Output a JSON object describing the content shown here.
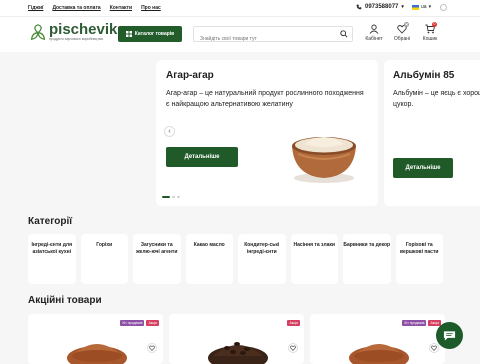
{
  "topbar": {
    "links": [
      "Гіджиї",
      "Доставка та оплата",
      "Контакти",
      "Про нас"
    ],
    "phone": "0973588077",
    "lang": "ua"
  },
  "header": {
    "logo_name": "pischevik",
    "logo_tagline": "продукти харчового виробництва",
    "catalog_label": "Каталог товарів",
    "search_placeholder": "Знайдіть свої товари тут",
    "icons": [
      {
        "label": "Кабінет",
        "icon": "user-icon"
      },
      {
        "label": "Обрані",
        "icon": "heart-icon",
        "count": "0"
      },
      {
        "label": "Кошик",
        "icon": "cart-icon",
        "count": "0"
      }
    ]
  },
  "hero": {
    "slides": [
      {
        "title": "Агар-агар",
        "text": "Агар-агар – це натуральний продукт рослинного походження є найкращою альтернативою желатину",
        "button": "Детальніше"
      },
      {
        "title": "Альбумін 85",
        "text": "Альбумін – це яєць є хорошим цукор.",
        "button": "Детальніше"
      }
    ],
    "prev": "‹",
    "next": "›"
  },
  "categories": {
    "title": "Категорії",
    "items": [
      "Інгреді-єнти для азіатської кухні",
      "Горіхи",
      "Загусники та желю-ючі агенти",
      "Какао масло",
      "Кондитер-ські інгреді-єнти",
      "Насіння та злаки",
      "Барвники та декор",
      "Горіхові та вершкові пасти"
    ]
  },
  "sale": {
    "title": "Акційні товари",
    "products": [
      {
        "badges": [
          "Хіт продажів",
          "Акція"
        ]
      },
      {
        "badges": [
          "Акція"
        ]
      },
      {
        "badges": [
          "Хіт продажів",
          "Акція"
        ]
      }
    ]
  },
  "colors": {
    "brand": "#215c2a",
    "sale": "#d63e5f",
    "hit": "#8e4fa6"
  }
}
